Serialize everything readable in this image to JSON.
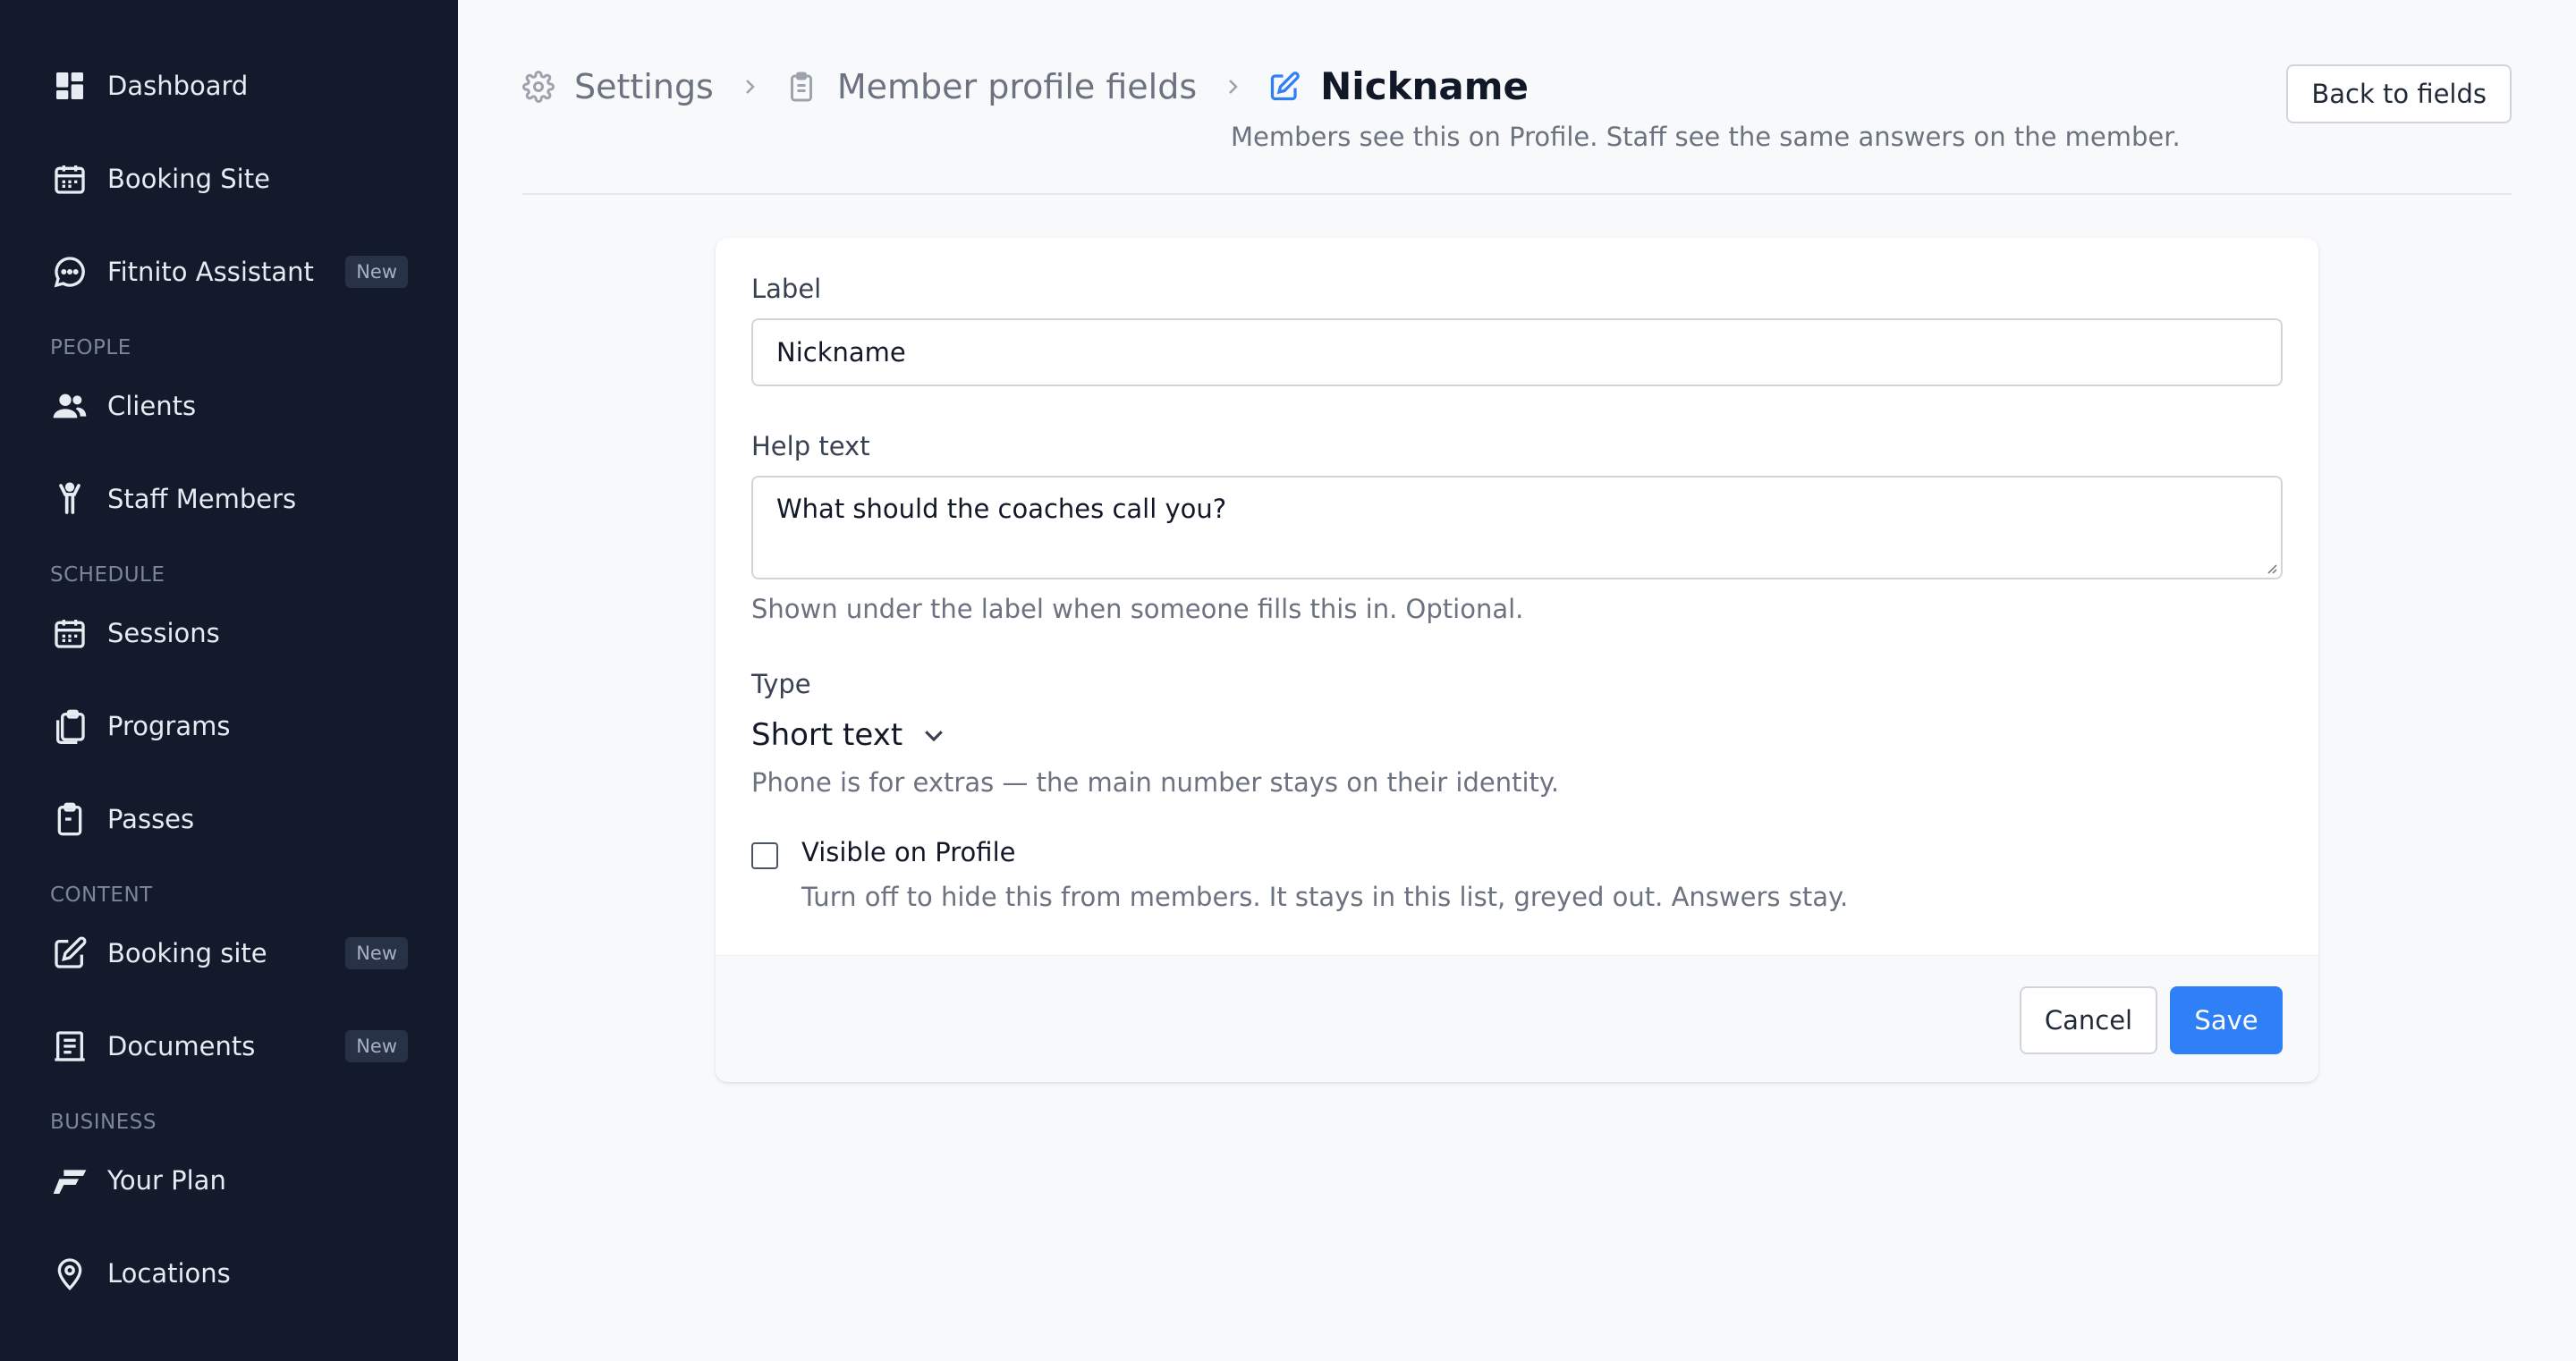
{
  "sidebar": {
    "items": [
      {
        "label": "Dashboard",
        "icon": "dashboard-icon"
      },
      {
        "label": "Booking Site",
        "icon": "calendar-icon"
      },
      {
        "label": "Fitnito Assistant",
        "icon": "chat-bubble-icon",
        "badge": "New"
      }
    ],
    "sections": [
      {
        "title": "PEOPLE",
        "items": [
          {
            "label": "Clients",
            "icon": "users-icon"
          },
          {
            "label": "Staff Members",
            "icon": "person-icon"
          }
        ]
      },
      {
        "title": "SCHEDULE",
        "items": [
          {
            "label": "Sessions",
            "icon": "calendar-icon"
          },
          {
            "label": "Programs",
            "icon": "clipboard-stack-icon"
          },
          {
            "label": "Passes",
            "icon": "clipboard-icon"
          }
        ]
      },
      {
        "title": "CONTENT",
        "items": [
          {
            "label": "Booking site",
            "icon": "edit-icon",
            "badge": "New"
          },
          {
            "label": "Documents",
            "icon": "document-icon",
            "badge": "New"
          }
        ]
      },
      {
        "title": "BUSINESS",
        "items": [
          {
            "label": "Your Plan",
            "icon": "fitnito-logo-icon"
          },
          {
            "label": "Locations",
            "icon": "location-pin-icon"
          }
        ]
      }
    ]
  },
  "header": {
    "breadcrumb": [
      {
        "label": "Settings",
        "icon": "gear-icon"
      },
      {
        "label": "Member profile fields",
        "icon": "clipboard-icon"
      },
      {
        "label": "Nickname",
        "icon": "edit-icon"
      }
    ],
    "subtitle": "Members see this on Profile. Staff see the same answers on the member.",
    "back_label": "Back to fields"
  },
  "form": {
    "label_title": "Label",
    "label_value": "Nickname",
    "help_title": "Help text",
    "help_value": "What should the coaches call you?",
    "help_hint": "Shown under the label when someone fills this in. Optional.",
    "type_title": "Type",
    "type_value": "Short text",
    "type_hint": "Phone is for extras — the main number stays on their identity.",
    "visible_title": "Visible on Profile",
    "visible_checked": false,
    "visible_desc": "Turn off to hide this from members. It stays in this list, greyed out. Answers stay.",
    "cancel_label": "Cancel",
    "save_label": "Save"
  },
  "colors": {
    "sidebar_bg": "#121a2c",
    "accent": "#2f7ff7",
    "page_bg": "#f8f9fb"
  }
}
